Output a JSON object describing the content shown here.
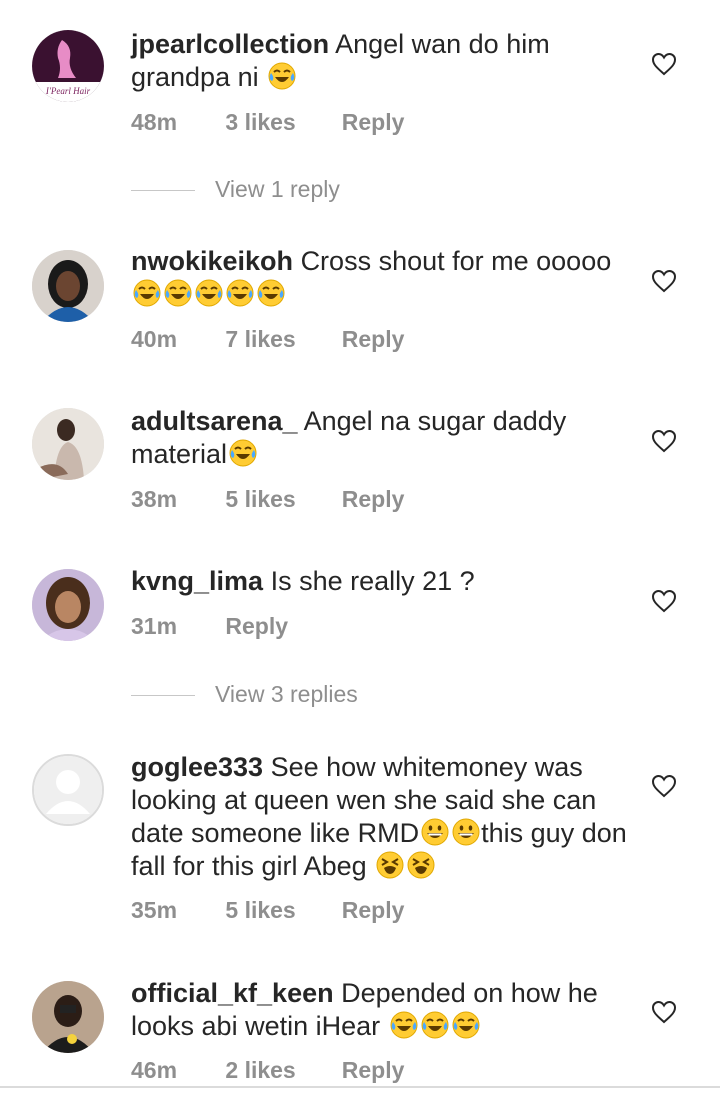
{
  "comments": [
    {
      "username": "jpearlcollection",
      "text": "Angel wan do him grandpa ni",
      "emojis": [
        "face-with-tears-of-joy"
      ],
      "time": "48m",
      "likes": "3 likes",
      "reply": "Reply",
      "avatar_label": "I'Pearl Hair"
    },
    {
      "username": "nwokikeikoh",
      "text": "Cross shout for me ooooo",
      "emojis": [
        "face-with-tears-of-joy",
        "face-with-tears-of-joy",
        "face-with-tears-of-joy",
        "face-with-tears-of-joy",
        "face-with-tears-of-joy"
      ],
      "time": "40m",
      "likes": "7 likes",
      "reply": "Reply"
    },
    {
      "username": "adultsarena_",
      "text": "Angel na sugar daddy material",
      "emojis": [
        "face-with-tears-of-joy"
      ],
      "time": "38m",
      "likes": "5 likes",
      "reply": "Reply"
    },
    {
      "username": "kvng_lima",
      "text": "Is she really 21 ?",
      "emojis": [],
      "time": "31m",
      "reply": "Reply"
    },
    {
      "username": "goglee333",
      "text_parts": [
        "See how whitemoney was looking at queen wen she said she can date someone like RMD",
        "this guy don fall for this girl Abeg "
      ],
      "emojis": [
        "grinning-face",
        "grinning-face",
        "tired-face",
        "tired-face"
      ],
      "time": "35m",
      "likes": "5 likes",
      "reply": "Reply"
    },
    {
      "username": "official_kf_keen",
      "text": "Depended on how he looks abi wetin iHear",
      "emojis": [
        "face-with-tears-of-joy",
        "face-with-tears-of-joy",
        "face-with-tears-of-joy"
      ],
      "time": "46m",
      "likes": "2 likes",
      "reply": "Reply"
    }
  ],
  "view_replies": [
    "View 1 reply",
    "View 3 replies"
  ],
  "icons": {
    "like": "heart-outline-icon"
  },
  "colors": {
    "text": "#262626",
    "meta": "#8e8e8e",
    "divider": "#c7c7c7"
  }
}
